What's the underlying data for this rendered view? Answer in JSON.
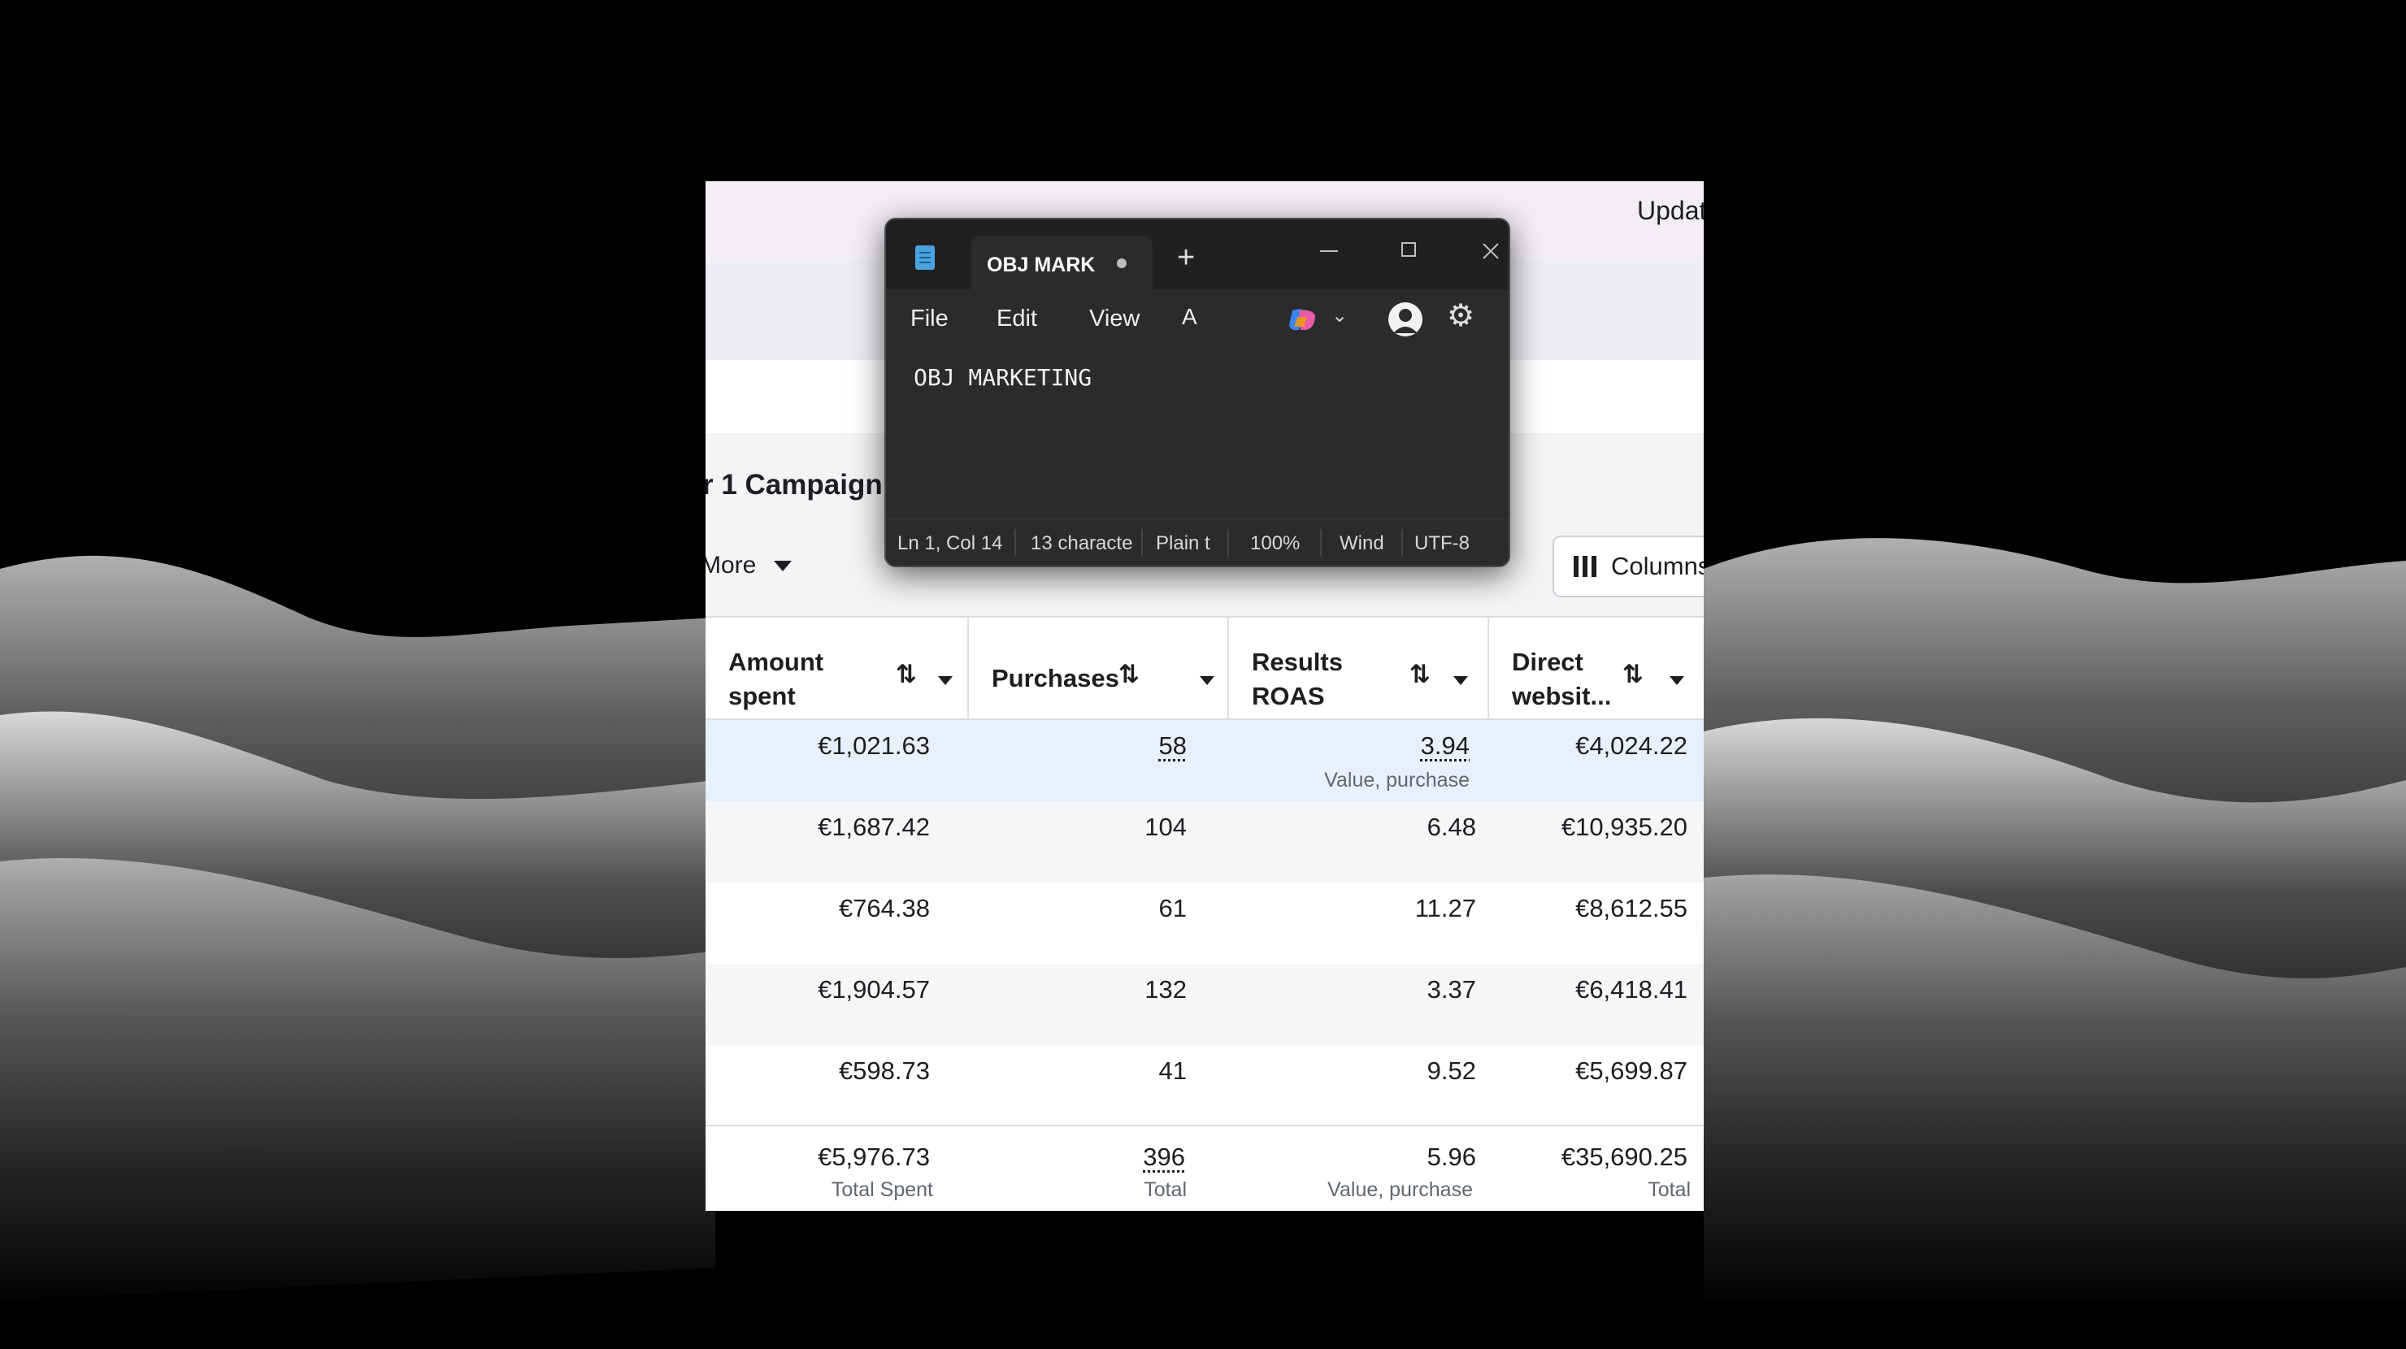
{
  "ads_manager": {
    "update_label": "Updat",
    "campaign_title": "r 1 Campaign",
    "more_label": "More",
    "columns_label": "Columns",
    "table": {
      "columns": [
        {
          "label_line1": "Amount",
          "label_line2": "spent",
          "sort_icon": "⇅"
        },
        {
          "label_line1": "Purchases",
          "label_line2": "",
          "sort_icon": "⇅"
        },
        {
          "label_line1": "Results",
          "label_line2": "ROAS",
          "sort_icon": "⇅"
        },
        {
          "label_line1": "Direct",
          "label_line2": "websit...",
          "sort_icon": "⇅"
        }
      ],
      "rows": [
        {
          "amount_spent": "€1,021.63",
          "purchases": "58",
          "roas": "3.94",
          "roas_sub": "Value, purchase",
          "direct_website": "€4,024.22"
        },
        {
          "amount_spent": "€1,687.42",
          "purchases": "104",
          "roas": "6.48",
          "roas_sub": "",
          "direct_website": "€10,935.20"
        },
        {
          "amount_spent": "€764.38",
          "purchases": "61",
          "roas": "11.27",
          "roas_sub": "",
          "direct_website": "€8,612.55"
        },
        {
          "amount_spent": "€1,904.57",
          "purchases": "132",
          "roas": "3.37",
          "roas_sub": "",
          "direct_website": "€6,418.41"
        },
        {
          "amount_spent": "€598.73",
          "purchases": "41",
          "roas": "9.52",
          "roas_sub": "",
          "direct_website": "€5,699.87"
        }
      ],
      "totals": {
        "amount_spent": "€5,976.73",
        "amount_spent_sub": "Total Spent",
        "purchases": "396",
        "purchases_sub": "Total",
        "roas": "5.96",
        "roas_sub": "Value, purchase",
        "direct_website": "€35,690.25",
        "direct_website_sub": "Total"
      }
    }
  },
  "notepad": {
    "tab_title": "OBJ MARK",
    "new_tab_symbol": "+",
    "menu": {
      "file": "File",
      "edit": "Edit",
      "view": "View"
    },
    "formatting_icon": "A",
    "copilot_chevron": "⌄",
    "settings_icon": "⚙",
    "content": "OBJ MARKETING",
    "status": {
      "position": "Ln 1, Col 14",
      "characters": "13 characte",
      "format": "Plain t",
      "zoom": "100%",
      "line_ending": "Wind",
      "encoding": "UTF-8"
    },
    "accent_color": "#4aa3df"
  },
  "icons": [
    "notepad-app-icon",
    "close-icon",
    "minimize-icon",
    "maximize-icon",
    "copilot-icon",
    "account-icon",
    "gear-icon",
    "sort-icon",
    "caret-down-icon",
    "columns-icon"
  ]
}
